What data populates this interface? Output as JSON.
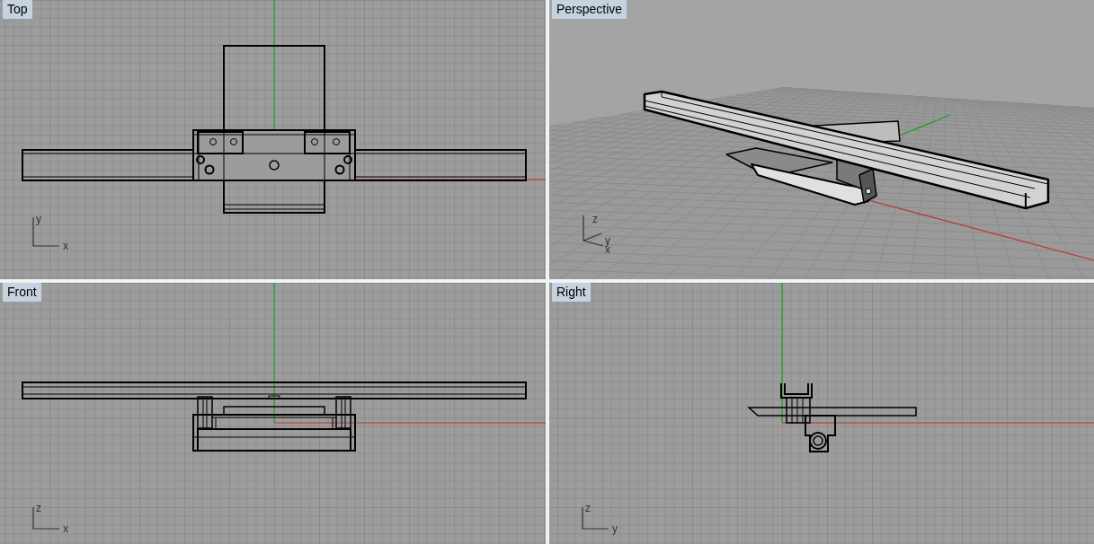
{
  "viewports": [
    {
      "label": "Top",
      "kind": "top",
      "axis_labels": [
        "y",
        "x"
      ]
    },
    {
      "label": "Perspective",
      "kind": "perspective",
      "axis_labels": [
        "z",
        "y",
        "x"
      ]
    },
    {
      "label": "Front",
      "kind": "front",
      "axis_labels": [
        "z",
        "x"
      ]
    },
    {
      "label": "Right",
      "kind": "right",
      "axis_labels": [
        "z",
        "y"
      ]
    }
  ]
}
